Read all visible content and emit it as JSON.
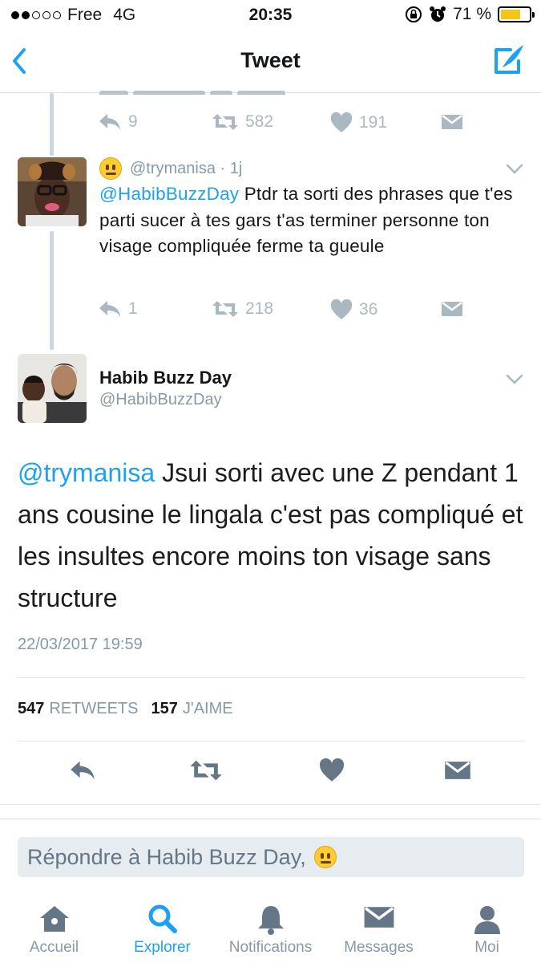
{
  "status_bar": {
    "carrier": "Free",
    "network": "4G",
    "time": "20:35",
    "battery": "71 %",
    "battery_level": 0.71,
    "signal_bars_filled": 2,
    "signal_bars_total": 5
  },
  "nav": {
    "title": "Tweet",
    "back_icon": "chevron-left-icon",
    "compose_icon": "compose-icon"
  },
  "prev_tweet": {
    "reply_count": "9",
    "retweet_count": "582",
    "like_count": "191"
  },
  "reply_tweet": {
    "handle_time": "@trymanisa · 1j",
    "mention": "@HabibBuzzDay",
    "text": " Ptdr ta sorti des phrases que t'es parti sucer à tes gars t'as terminer personne ton visage compliquée ferme ta gueule",
    "reply_count": "1",
    "retweet_count": "218",
    "like_count": "36"
  },
  "main_tweet": {
    "author_name": "Habib Buzz Day",
    "author_handle": "@HabibBuzzDay",
    "mention": "@trymanisa",
    "text": " Jsui sorti avec une Z pendant 1 ans cousine le lingala c'est pas compliqué et les insultes encore moins ton visage sans structure",
    "timestamp": "22/03/2017 19:59",
    "retweets_count": "547",
    "retweets_label": "RETWEETS",
    "likes_count": "157",
    "likes_label": "J'AIME"
  },
  "reply_box": {
    "placeholder": "Répondre à Habib Buzz Day,"
  },
  "tab_bar": {
    "tabs": [
      {
        "label": "Accueil",
        "icon": "home-icon"
      },
      {
        "label": "Explorer",
        "icon": "search-icon"
      },
      {
        "label": "Notifications",
        "icon": "bell-icon"
      },
      {
        "label": "Messages",
        "icon": "envelope-icon"
      },
      {
        "label": "Moi",
        "icon": "person-icon"
      }
    ]
  },
  "colors": {
    "accent": "#1da1f2",
    "muted": "#8899a6",
    "action_gray": "#aab8c2",
    "icon_dark": "#657786"
  }
}
